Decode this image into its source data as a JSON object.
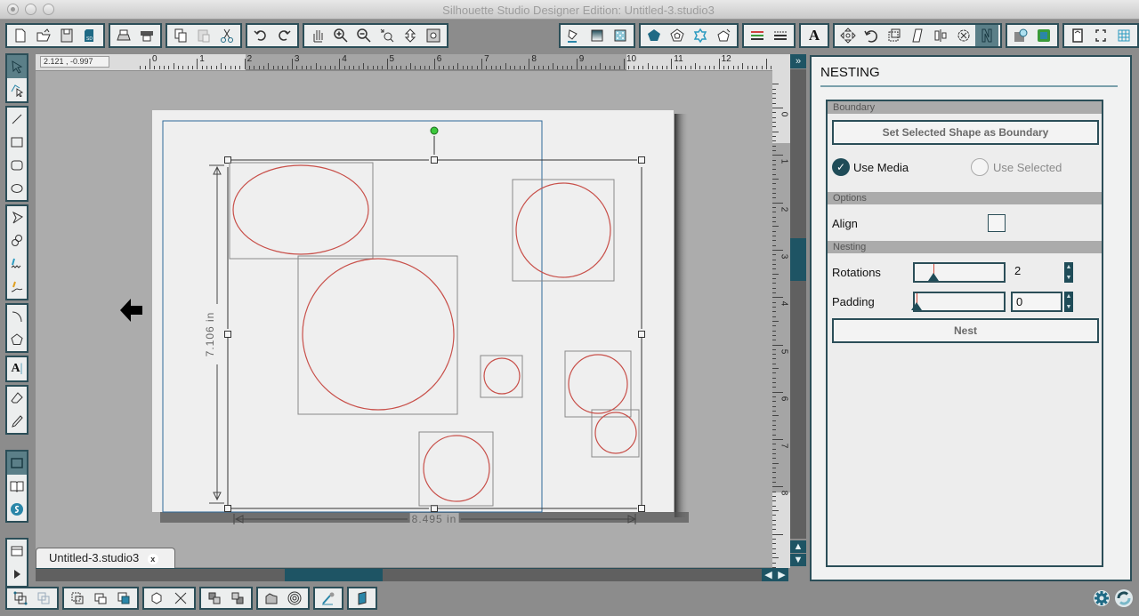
{
  "window": {
    "title": "Silhouette Studio Designer Edition: Untitled-3.studio3"
  },
  "toolbar_left": [
    [
      "new-document-icon",
      "open-file-icon",
      "save-icon",
      "save-to-sd-icon"
    ],
    [
      "print-icon",
      "send-to-cutter-icon"
    ],
    [
      "copy-icon",
      "paste-icon",
      "cut-icon"
    ],
    [
      "undo-icon",
      "redo-icon"
    ],
    [
      "pan-hand-icon",
      "zoom-in-icon",
      "zoom-out-icon",
      "zoom-select-icon",
      "zoom-drag-icon",
      "fit-to-page-icon"
    ]
  ],
  "toolbar_right": [
    [
      "fill-color-icon",
      "fill-gradient-icon",
      "fill-pattern-icon"
    ],
    [
      "line-color-icon",
      "line-style-icon",
      "shape-style-icon",
      "offset-style-icon"
    ],
    [
      "line-settings-icon",
      "line-dash-icon"
    ],
    [
      "text-style-icon"
    ],
    [
      "transform-icon",
      "rotate-icon",
      "scale-icon",
      "shear-icon",
      "align-icon",
      "replicate-icon",
      "nesting-icon"
    ],
    [
      "modify-icon",
      "offset-icon"
    ],
    [
      "page-settings-icon",
      "registration-marks-icon",
      "grid-icon"
    ],
    [
      "cut-settings-icon",
      "send-icon"
    ]
  ],
  "coord_readout": "2.121 , -0.997",
  "ruler_h_labels": [
    "0",
    "1",
    "2",
    "3",
    "4",
    "5",
    "6",
    "7",
    "8",
    "9",
    "10",
    "11",
    "12"
  ],
  "ruler_v_labels": [
    "0",
    "1",
    "2",
    "3",
    "4",
    "5",
    "6",
    "7",
    "8"
  ],
  "dimensions": {
    "height_label": "7.106 in",
    "width_label": "8.495 in"
  },
  "document_tab": {
    "label": "Untitled-3.studio3",
    "close": "x"
  },
  "nesting_panel": {
    "title": "NESTING",
    "boundary_section": "Boundary",
    "set_boundary_button": "Set Selected Shape as Boundary",
    "use_media_label": "Use Media",
    "use_media_checked": true,
    "use_selected_label": "Use Selected",
    "use_selected_checked": false,
    "options_section": "Options",
    "align_label": "Align",
    "align_checked": false,
    "nesting_section": "Nesting",
    "rotations_label": "Rotations",
    "rotations_value": "2",
    "padding_label": "Padding",
    "padding_value": "0",
    "nest_button": "Nest"
  },
  "colors": {
    "accent": "#1f4c58",
    "shape_stroke": "#c8504a",
    "selection_green": "#3cc83c",
    "cut_border": "#2f6a99"
  }
}
